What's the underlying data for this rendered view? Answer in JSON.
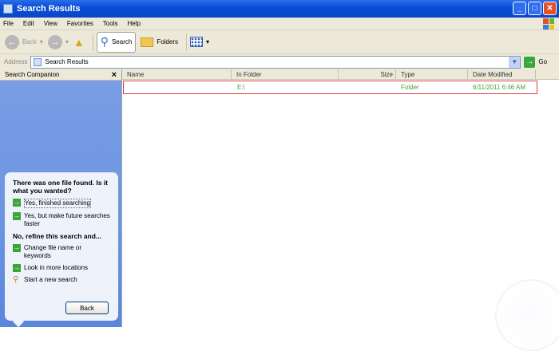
{
  "window": {
    "title": "Search Results",
    "min": "_",
    "max": "□",
    "close": "✕"
  },
  "menu": [
    "File",
    "Edit",
    "View",
    "Favorites",
    "Tools",
    "Help"
  ],
  "toolbar": {
    "back": "Back",
    "search": "Search",
    "folders": "Folders"
  },
  "address": {
    "label": "Address",
    "value": "Search Results",
    "go": "Go"
  },
  "companion": {
    "title": "Search Companion",
    "close": "×",
    "heading": "There was one file found.  Is it what you wanted?",
    "options": [
      "Yes, finished searching",
      "Yes, but make future searches faster"
    ],
    "refine_heading": "No, refine this search and...",
    "refine_options": [
      "Change file name or keywords",
      "Look in more locations"
    ],
    "new_search": "Start a new search",
    "back": "Back"
  },
  "columns": [
    "Name",
    "In Folder",
    "Size",
    "Type",
    "Date Modified"
  ],
  "rows": [
    {
      "name": "",
      "folder": "E:\\",
      "size": "",
      "type": "Folder",
      "modified": "6/11/2011 6:46 AM"
    }
  ],
  "colors": {
    "accent": "#0a4fd6",
    "result_text": "#3aa53a",
    "selection_border": "#d94040"
  }
}
